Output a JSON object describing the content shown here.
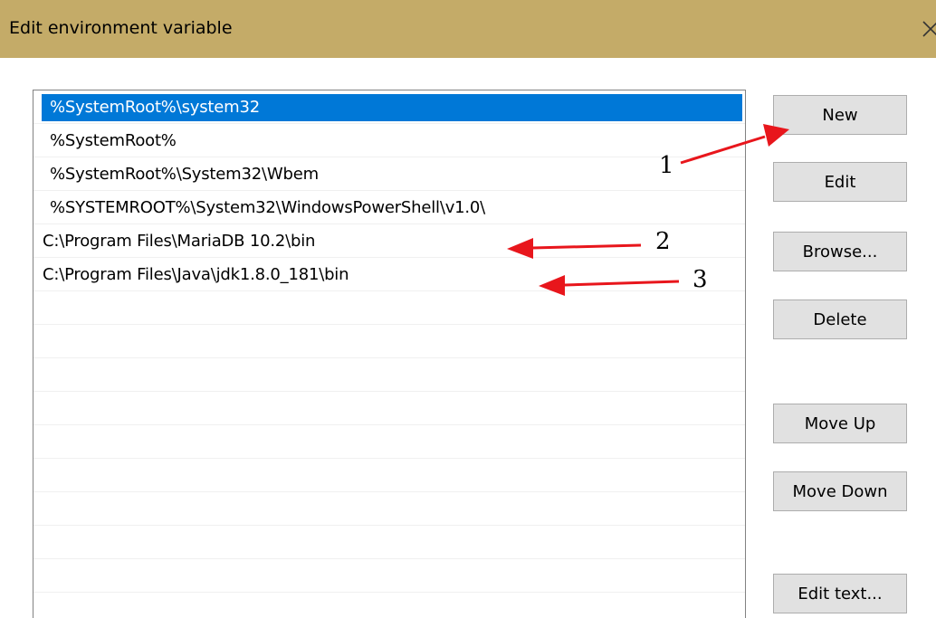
{
  "window": {
    "title": "Edit environment variable",
    "close_icon": "close-icon"
  },
  "list": {
    "items": [
      {
        "text": "%SystemRoot%\\system32",
        "selected": true
      },
      {
        "text": "%SystemRoot%",
        "selected": false
      },
      {
        "text": "%SystemRoot%\\System32\\Wbem",
        "selected": false
      },
      {
        "text": "%SYSTEMROOT%\\System32\\WindowsPowerShell\\v1.0\\",
        "selected": false
      },
      {
        "text": "C:\\Program Files\\MariaDB 10.2\\bin",
        "selected": false
      },
      {
        "text": "C:\\Program Files\\Java\\jdk1.8.0_181\\bin",
        "selected": false
      }
    ]
  },
  "buttons": {
    "new": "New",
    "edit": "Edit",
    "browse": "Browse...",
    "delete": "Delete",
    "move_up": "Move Up",
    "move_down": "Move Down",
    "edit_text": "Edit text..."
  },
  "annotations": {
    "one": "1",
    "two": "2",
    "three": "3",
    "arrow_color": "#e8161c"
  },
  "colors": {
    "titlebar": "#c4ab68",
    "selection": "#0078d7",
    "button_bg": "#e1e1e1"
  }
}
